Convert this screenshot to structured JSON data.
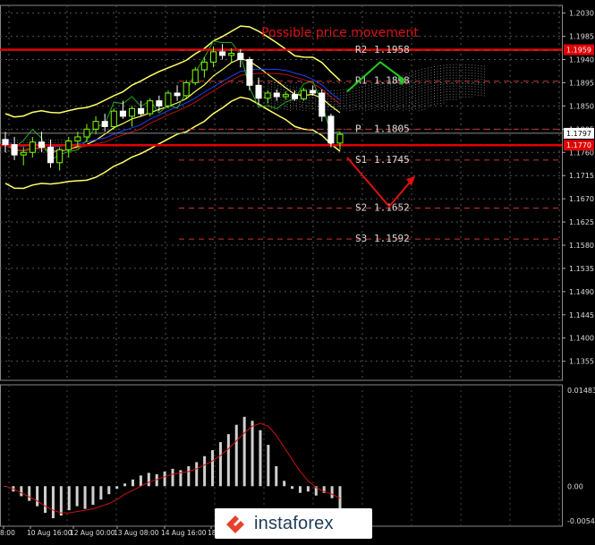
{
  "chart_data": {
    "type": "candlestick",
    "title": "Possible price movement",
    "main_panel": {
      "ylim": [
        1.1318,
        1.2045
      ],
      "price_ticks": [
        "1.2030",
        "1.1985",
        "1.1940",
        "1.1895",
        "1.1850",
        "1.1805",
        "1.1760",
        "1.1715",
        "1.1670",
        "1.1625",
        "1.1580",
        "1.1535",
        "1.1490",
        "1.1445",
        "1.1400",
        "1.1355"
      ],
      "current_price_label": "1.1797",
      "current_price": 1.1797,
      "red_level_label_1": "1.1959",
      "red_level_1": 1.1959,
      "red_level_label_2": "1.1770",
      "red_level_2": 1.1774,
      "grid": true,
      "candles": [
        [
          1.1785,
          1.18,
          1.176,
          1.1775
        ],
        [
          1.1775,
          1.179,
          1.1745,
          1.1755
        ],
        [
          1.1755,
          1.177,
          1.1735,
          1.176
        ],
        [
          1.176,
          1.179,
          1.175,
          1.178
        ],
        [
          1.178,
          1.18,
          1.176,
          1.177
        ],
        [
          1.177,
          1.1785,
          1.173,
          1.174
        ],
        [
          1.174,
          1.177,
          1.1725,
          1.1765
        ],
        [
          1.1765,
          1.179,
          1.175,
          1.1782
        ],
        [
          1.1782,
          1.18,
          1.177,
          1.179
        ],
        [
          1.179,
          1.1815,
          1.178,
          1.1805
        ],
        [
          1.1805,
          1.183,
          1.1795,
          1.182
        ],
        [
          1.182,
          1.1835,
          1.18,
          1.181
        ],
        [
          1.181,
          1.1845,
          1.1805,
          1.184
        ],
        [
          1.184,
          1.186,
          1.1825,
          1.183
        ],
        [
          1.183,
          1.185,
          1.181,
          1.1845
        ],
        [
          1.1845,
          1.186,
          1.183,
          1.1835
        ],
        [
          1.1835,
          1.1865,
          1.183,
          1.186
        ],
        [
          1.186,
          1.187,
          1.184,
          1.185
        ],
        [
          1.185,
          1.188,
          1.1845,
          1.1875
        ],
        [
          1.1875,
          1.189,
          1.186,
          1.187
        ],
        [
          1.187,
          1.19,
          1.1865,
          1.1895
        ],
        [
          1.1895,
          1.1925,
          1.189,
          1.192
        ],
        [
          1.192,
          1.1945,
          1.1905,
          1.1935
        ],
        [
          1.1935,
          1.1965,
          1.1925,
          1.1955
        ],
        [
          1.1955,
          1.197,
          1.194,
          1.1948
        ],
        [
          1.1948,
          1.1962,
          1.1935,
          1.1952
        ],
        [
          1.1952,
          1.196,
          1.1925,
          1.194
        ],
        [
          1.194,
          1.1945,
          1.188,
          1.189
        ],
        [
          1.189,
          1.1905,
          1.1855,
          1.1865
        ],
        [
          1.1865,
          1.188,
          1.1855,
          1.1875
        ],
        [
          1.1875,
          1.1882,
          1.186,
          1.1868
        ],
        [
          1.1868,
          1.1878,
          1.1862,
          1.1872
        ],
        [
          1.1872,
          1.188,
          1.186,
          1.1864
        ],
        [
          1.1864,
          1.1885,
          1.186,
          1.188
        ],
        [
          1.188,
          1.189,
          1.187,
          1.1875
        ],
        [
          1.1875,
          1.1882,
          1.182,
          1.183
        ],
        [
          1.183,
          1.1835,
          1.177,
          1.1778
        ],
        [
          1.1778,
          1.18,
          1.1765,
          1.1795
        ]
      ],
      "pivot_levels": [
        {
          "label": "R2",
          "value": 1.1958,
          "text": "1.1958"
        },
        {
          "label": "R1",
          "value": 1.1898,
          "text": "1.1898"
        },
        {
          "label": "P",
          "value": 1.1805,
          "text": "1.1805"
        },
        {
          "label": "S1",
          "value": 1.1745,
          "text": "1.1745"
        },
        {
          "label": "S2",
          "value": 1.1652,
          "text": "1.1652"
        },
        {
          "label": "S3",
          "value": 1.1592,
          "text": "1.1592"
        }
      ],
      "green_path": [
        [
          0,
          1.1878
        ],
        [
          1,
          1.1935
        ],
        [
          2,
          1.19
        ]
      ],
      "red_path": [
        [
          0,
          1.175
        ],
        [
          1,
          1.1655
        ],
        [
          2,
          1.171
        ]
      ]
    },
    "macd_panel": {
      "ticks": [
        "0.01483",
        "0.00",
        "-0.00541"
      ],
      "ylim": [
        -0.006,
        0.0152
      ],
      "histogram": [
        0.0,
        -0.0008,
        -0.0015,
        -0.0022,
        -0.003,
        -0.004,
        -0.0048,
        -0.0044,
        -0.0036,
        -0.003,
        -0.0034,
        -0.0028,
        -0.002,
        -0.0012,
        -0.0004,
        0.0004,
        0.001,
        0.0016,
        0.002,
        0.0018,
        0.0022,
        0.0026,
        0.0024,
        0.003,
        0.0036,
        0.0045,
        0.0054,
        0.0066,
        0.0078,
        0.0092,
        0.0104,
        0.0098,
        0.0084,
        0.0062,
        0.003,
        0.0008,
        -0.0004,
        -0.001,
        -0.0008,
        -0.0014,
        -0.001,
        -0.0018,
        -0.0036
      ],
      "signal": [
        0.0,
        -0.0004,
        -0.001,
        -0.0016,
        -0.0022,
        -0.003,
        -0.0036,
        -0.004,
        -0.004,
        -0.0038,
        -0.0036,
        -0.0034,
        -0.003,
        -0.0026,
        -0.002,
        -0.0012,
        -0.0006,
        0.0,
        0.0006,
        0.001,
        0.0014,
        0.0018,
        0.002,
        0.0022,
        0.0026,
        0.0032,
        0.0038,
        0.0046,
        0.0056,
        0.0068,
        0.008,
        0.009,
        0.0094,
        0.009,
        0.0076,
        0.0058,
        0.004,
        0.0022,
        0.0008,
        -0.0002,
        -0.0008,
        -0.0012,
        -0.0018
      ]
    },
    "x_ticks": [
      "8:00",
      "10 Aug 16:00",
      "12 Aug 00:00",
      "13 Aug 08:00",
      "14 Aug 16:00",
      "18 A"
    ]
  },
  "watermark": {
    "text": "instaforex"
  },
  "colors": {
    "background": "#000000",
    "bull_candle": "#7fff00",
    "bear_candle": "#ffffff",
    "bollinger": "#ffff66",
    "red_line": "#e00000",
    "title": "#dd1111",
    "green_arrow": "#22cc22",
    "red_arrow": "#dd1111",
    "pivot_text": "#d8d8d8",
    "macd_hist": "#d0d0d0",
    "macd_signal": "#cc1111"
  }
}
